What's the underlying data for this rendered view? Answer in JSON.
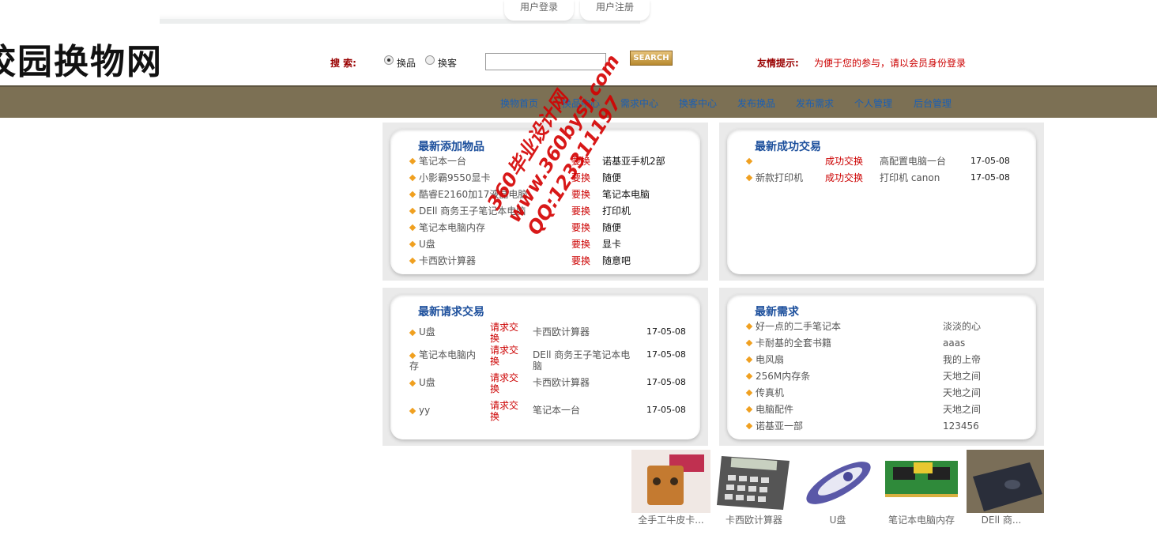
{
  "header": {
    "login_tab": "用户登录",
    "register_tab": "用户注册",
    "logo_text": "校园换物网"
  },
  "search": {
    "label": "搜  索:",
    "options": [
      "换品",
      "换客"
    ],
    "selected": "换品",
    "input_value": "",
    "button_label": "SEARCH",
    "tip_label": "友情提示:",
    "tip_text": "为便于您的参与，请以会员身份登录"
  },
  "nav": {
    "items": [
      "换物首页",
      "换品中心",
      "需求中心",
      "换客中心",
      "发布换品",
      "发布需求",
      "个人管理",
      "后台管理"
    ]
  },
  "latest_items": {
    "title": "最新添加物品",
    "rows": [
      {
        "name": "笔记本一台",
        "tag": "要换",
        "want": "诺基亚手机2部"
      },
      {
        "name": "小影霸9550显卡",
        "tag": "要换",
        "want": "随便"
      },
      {
        "name": "酷睿E2160加17液晶电脑",
        "tag": "要换",
        "want": "笔记本电脑"
      },
      {
        "name": "DEll 商务王子笔记本电脑",
        "tag": "要换",
        "want": "打印机"
      },
      {
        "name": "笔记本电脑内存",
        "tag": "要换",
        "want": "随便"
      },
      {
        "name": "U盘",
        "tag": "要换",
        "want": "显卡"
      },
      {
        "name": "卡西欧计算器",
        "tag": "要换",
        "want": "随意吧"
      }
    ]
  },
  "success_trades": {
    "title": "最新成功交易",
    "rows": [
      {
        "name": "",
        "tag": "成功交换",
        "with": "高配置电脑一台",
        "date": "17-05-08"
      },
      {
        "name": "新款打印机",
        "tag": "成功交换",
        "with": "打印机 canon",
        "date": "17-05-08"
      }
    ]
  },
  "request_trades": {
    "title": "最新请求交易",
    "rows": [
      {
        "name": "U盘",
        "tag": "请求交换",
        "with": "卡西欧计算器",
        "date": "17-05-08"
      },
      {
        "name": "笔记本电脑内存",
        "tag": "请求交换",
        "with": "DEll 商务王子笔记本电脑",
        "date": "17-05-08"
      },
      {
        "name": "U盘",
        "tag": "请求交换",
        "with": "卡西欧计算器",
        "date": "17-05-08"
      },
      {
        "name": "yy",
        "tag": "请求交换",
        "with": "笔记本一台",
        "date": "17-05-08"
      }
    ]
  },
  "latest_needs": {
    "title": "最新需求",
    "rows": [
      {
        "name": "好一点的二手笔记本",
        "user": "淡淡的心"
      },
      {
        "name": "卡耐基的全套书籍",
        "user": "aaas"
      },
      {
        "name": "电风扇",
        "user": "我的上帝"
      },
      {
        "name": "256M内存条",
        "user": "天地之间"
      },
      {
        "name": "传真机",
        "user": "天地之间"
      },
      {
        "name": "电脑配件",
        "user": "天地之间"
      },
      {
        "name": "诺基亚一部",
        "user": "123456"
      }
    ]
  },
  "products": [
    {
      "caption": "全手工牛皮卡...",
      "icon": "leather-card-holder"
    },
    {
      "caption": "卡西欧计算器",
      "icon": "calculator"
    },
    {
      "caption": "U盘",
      "icon": "usb-drive"
    },
    {
      "caption": "笔记本电脑内存",
      "icon": "ram-module"
    },
    {
      "caption": "DEll 商...",
      "icon": "laptop"
    }
  ],
  "watermark": {
    "line1": "360毕业设计网",
    "line2": "www.360bysj.com",
    "line3": "QQ:123311197"
  },
  "colors": {
    "navbar": "#7c7054",
    "accent_red": "#cc0000",
    "title_blue": "#1c4f9c",
    "bullet": "#f0a020"
  }
}
